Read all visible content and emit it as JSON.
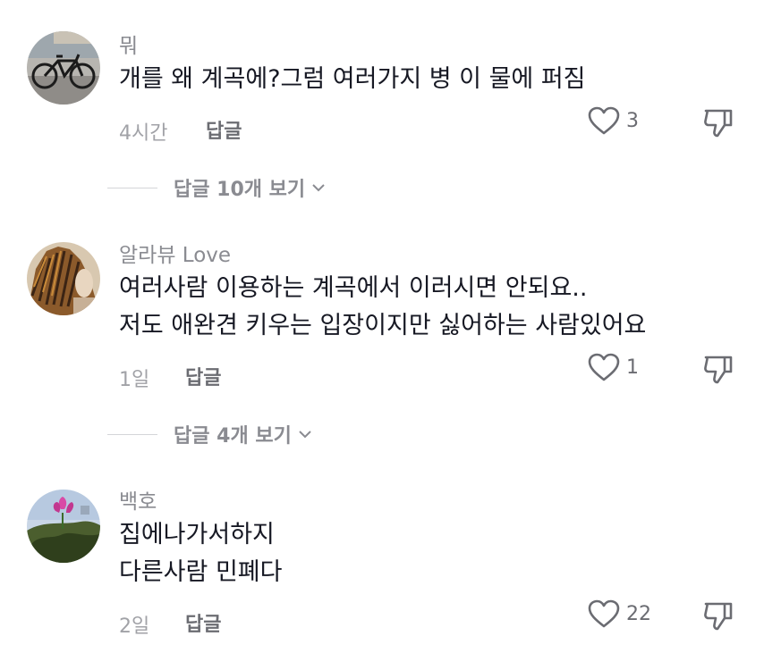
{
  "comments": [
    {
      "username": "뭐",
      "lines": [
        "개를 왜 계곡에?그럼 여러가지 병 이 물에 퍼짐"
      ],
      "time": "4시간",
      "reply_label": "답글",
      "likes": "3",
      "view_replies": "답글 10개 보기",
      "avatar_icon": "bicycle-photo"
    },
    {
      "username": "알라뷰 Love",
      "lines": [
        "여러사람 이용하는 계곡에서 이러시면 안되요..",
        "저도 애완견 키우는 입장이지만 싫어하는 사람있어요"
      ],
      "time": "1일",
      "reply_label": "답글",
      "likes": "1",
      "view_replies": "답글 4개 보기",
      "avatar_icon": "feather-headdress-photo"
    },
    {
      "username": "백호",
      "lines": [
        "집에나가서하지",
        "다른사람 민폐다"
      ],
      "time": "2일",
      "reply_label": "답글",
      "likes": "22",
      "avatar_icon": "lotus-flower-photo"
    }
  ],
  "colors": {
    "text": "#161823",
    "muted": "#8a8b91",
    "icon": "#6b6c72"
  }
}
